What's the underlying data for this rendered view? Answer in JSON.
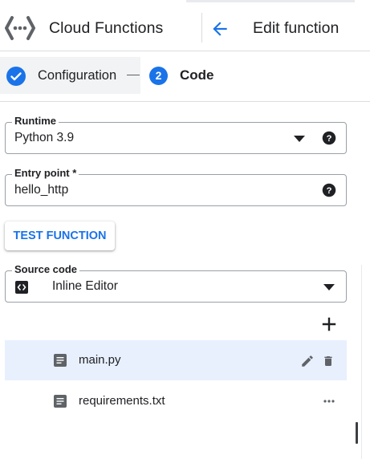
{
  "header": {
    "product_title": "Cloud Functions",
    "page_title": "Edit function",
    "logo_icon": "cloud-functions-logo",
    "back_icon": "arrow-back-icon"
  },
  "stepper": {
    "steps": [
      {
        "label": "Configuration",
        "state": "complete"
      },
      {
        "number": "2",
        "label": "Code",
        "state": "active"
      }
    ]
  },
  "form": {
    "runtime": {
      "label": "Runtime",
      "value": "Python 3.9"
    },
    "entry_point": {
      "label": "Entry point *",
      "value": "hello_http"
    },
    "test_button": "TEST FUNCTION",
    "source_code": {
      "label": "Source code",
      "value": "Inline Editor",
      "icon": "code-icon"
    }
  },
  "files": [
    {
      "name": "main.py",
      "selected": true,
      "actions": [
        "edit",
        "delete"
      ]
    },
    {
      "name": "requirements.txt",
      "selected": false,
      "actions": [
        "more"
      ]
    }
  ],
  "colors": {
    "accent": "#1a73e8",
    "selected_row": "#e8f0fe",
    "border": "#dadce0",
    "text": "#202124",
    "icon": "#5f6368"
  }
}
